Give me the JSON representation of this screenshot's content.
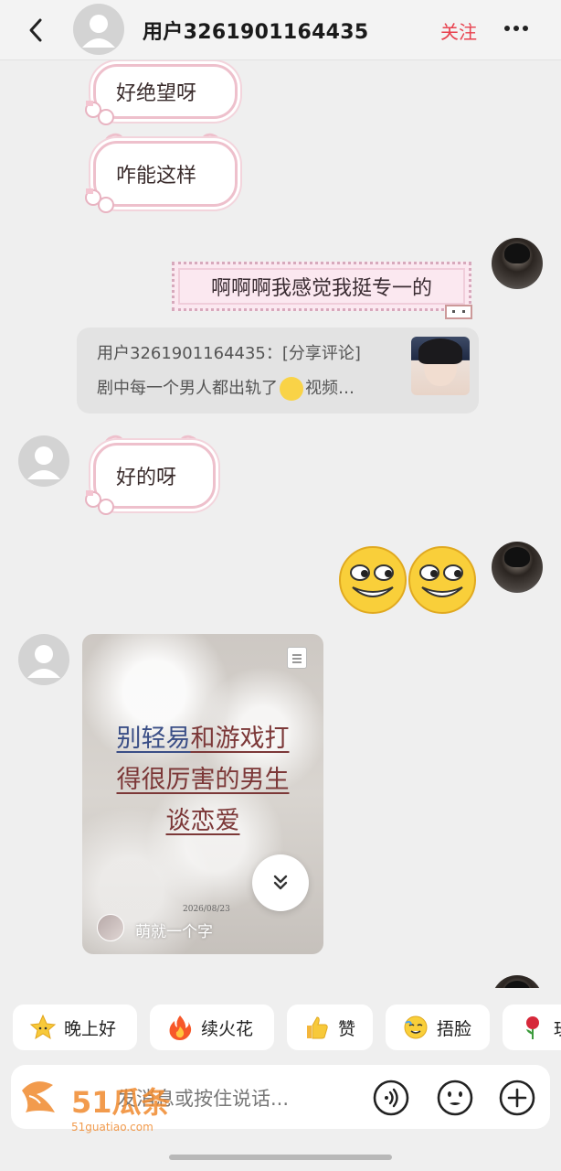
{
  "header": {
    "title": "用户3261901164435",
    "follow_label": "关注"
  },
  "messages": {
    "m1_text": "好绝望呀",
    "m2_text": "咋能这样",
    "m3_text": "啊啊啊我感觉我挺专一的",
    "share_line1": "用户3261901164435：[分享评论]",
    "share_line2_a": "剧中每一个男人都出轨了",
    "share_line2_b": "视频…",
    "m4_text": "好的呀",
    "video_line1_a": "别轻易",
    "video_line1_b": "和游戏打",
    "video_line2": "得很厉害的男生",
    "video_line3": "谈恋爱",
    "video_date": "2026/08/23",
    "video_author": "萌就一个字"
  },
  "quick_replies": [
    {
      "label": "晚上好",
      "icon": "star-face-icon"
    },
    {
      "label": "续火花",
      "icon": "fire-icon"
    },
    {
      "label": "赞",
      "icon": "thumbs-up-icon"
    },
    {
      "label": "捂脸",
      "icon": "facepalm-icon"
    },
    {
      "label": "玫",
      "icon": "rose-icon"
    }
  ],
  "input": {
    "placeholder": "发消息或按住说话..."
  },
  "watermark": {
    "text": "51瓜条",
    "sub": "51guatiao.com"
  },
  "colors": {
    "accent": "#e8414e",
    "bubble_border": "#eec0cc"
  }
}
